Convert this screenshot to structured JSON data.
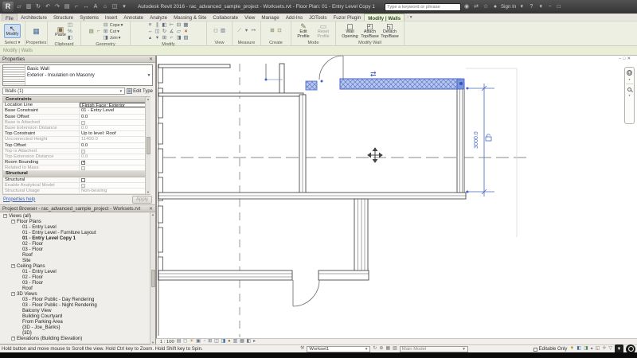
{
  "title_bar": {
    "app_title": "Autodesk Revit 2016 - rac_advanced_sample_project - Worksets.rvt - Floor Plan: 01 - Entry Level Copy 1",
    "search_placeholder": "Type a keyword or phrase",
    "sign_in": "Sign In"
  },
  "ribbon": {
    "tabs": [
      "File",
      "Architecture",
      "Structure",
      "Systems",
      "Insert",
      "Annotate",
      "Analyze",
      "Massing & Site",
      "Collaborate",
      "View",
      "Manage",
      "Add-Ins",
      "JOTools",
      "Fuzor Plugin"
    ],
    "active_tab": "Modify | Walls",
    "select_button": "Modify",
    "paste_label": "Paste",
    "captions": {
      "select": "Select ▾",
      "properties": "Properties",
      "clipboard": "Clipboard",
      "geometry": "Geometry",
      "modify": "Modify",
      "view": "View",
      "measure": "Measure",
      "create": "Create",
      "mode": "Mode",
      "modify_wall": "Modify Wall"
    },
    "geometry_items": [
      "Cope",
      "Cut",
      "Join"
    ],
    "mode_buttons": [
      "Edit Profile",
      "Reset Profile"
    ],
    "wall_buttons": [
      "Wall Opening",
      "Attach Top/Base",
      "Detach Top/Base"
    ]
  },
  "options_bar": {
    "label": "Modify | Walls"
  },
  "properties_panel": {
    "title": "Properties",
    "type_name": "Basic Wall",
    "type_description": "Exterior - Insulation on Masonry",
    "selection_filter": "Walls (1)",
    "edit_type_label": "Edit Type",
    "rows": [
      {
        "label": "Constraints",
        "value": "",
        "state": "section"
      },
      {
        "label": "Location Line",
        "value": "Finish Face: Exterior",
        "state": "editing"
      },
      {
        "label": "Base Constraint",
        "value": "01 - Entry Level",
        "state": "normal"
      },
      {
        "label": "Base Offset",
        "value": "0.0",
        "state": "normal"
      },
      {
        "label": "Base is Attached",
        "value": "unchecked",
        "state": "checkbox-disabled"
      },
      {
        "label": "Base Extension Distance",
        "value": "0.0",
        "state": "disabled"
      },
      {
        "label": "Top Constraint",
        "value": "Up to level: Roof",
        "state": "normal"
      },
      {
        "label": "Unconnected Height",
        "value": "11400.0",
        "state": "disabled"
      },
      {
        "label": "Top Offset",
        "value": "0.0",
        "state": "normal"
      },
      {
        "label": "Top is Attached",
        "value": "unchecked",
        "state": "checkbox-disabled"
      },
      {
        "label": "Top Extension Distance",
        "value": "0.0",
        "state": "disabled"
      },
      {
        "label": "Room Bounding",
        "value": "checked",
        "state": "checkbox-checked"
      },
      {
        "label": "Related to Mass",
        "value": "unchecked",
        "state": "checkbox-disabled"
      },
      {
        "label": "Structural",
        "value": "",
        "state": "section"
      },
      {
        "label": "Structural",
        "value": "unchecked",
        "state": "checkbox"
      },
      {
        "label": "Enable Analytical Model",
        "value": "unchecked",
        "state": "checkbox-disabled"
      },
      {
        "label": "Structural Usage",
        "value": "Non-bearing",
        "state": "disabled"
      }
    ],
    "help_link": "Properties help",
    "apply_label": "Apply"
  },
  "project_browser": {
    "title": "Project Browser - rac_advanced_sample_project - Worksets.rvt",
    "items": [
      {
        "label": "Views (all)",
        "depth": 0
      },
      {
        "label": "Floor Plans",
        "depth": 1
      },
      {
        "label": "01 - Entry Level",
        "depth": 2
      },
      {
        "label": "01 - Entry Level - Furniture Layout",
        "depth": 2
      },
      {
        "label": "01 - Entry Level Copy 1",
        "depth": 2,
        "selected": true
      },
      {
        "label": "02 - Floor",
        "depth": 2
      },
      {
        "label": "03 - Floor",
        "depth": 2
      },
      {
        "label": "Roof",
        "depth": 2
      },
      {
        "label": "Site",
        "depth": 2
      },
      {
        "label": "Ceiling Plans",
        "depth": 1
      },
      {
        "label": "01 - Entry Level",
        "depth": 2
      },
      {
        "label": "02 - Floor",
        "depth": 2
      },
      {
        "label": "03 - Floor",
        "depth": 2
      },
      {
        "label": "Roof",
        "depth": 2
      },
      {
        "label": "3D Views",
        "depth": 1
      },
      {
        "label": "03 - Floor Public - Day Rendering",
        "depth": 2
      },
      {
        "label": "03 - Floor Public - Night Rendering",
        "depth": 2
      },
      {
        "label": "Balcony View",
        "depth": 2
      },
      {
        "label": "Building Courtyard",
        "depth": 2
      },
      {
        "label": "From Parking Area",
        "depth": 2
      },
      {
        "label": "{3D - Joe_Banks}",
        "depth": 2
      },
      {
        "label": "{3D}",
        "depth": 2
      },
      {
        "label": "Elevations (Building Elevation)",
        "depth": 1
      }
    ]
  },
  "canvas": {
    "temp_dimension": "3000.0",
    "selection_color": "#3f62c4"
  },
  "view_control_bar": {
    "scale": "1 : 100"
  },
  "status_bar": {
    "hint": "Hold button and move mouse to Scroll the view. Hold Ctrl key to Zoom. Hold Shift key to Spin.",
    "active_workset": "Workset1",
    "design_option": "Main Model",
    "editable_only_label": "Editable Only"
  }
}
